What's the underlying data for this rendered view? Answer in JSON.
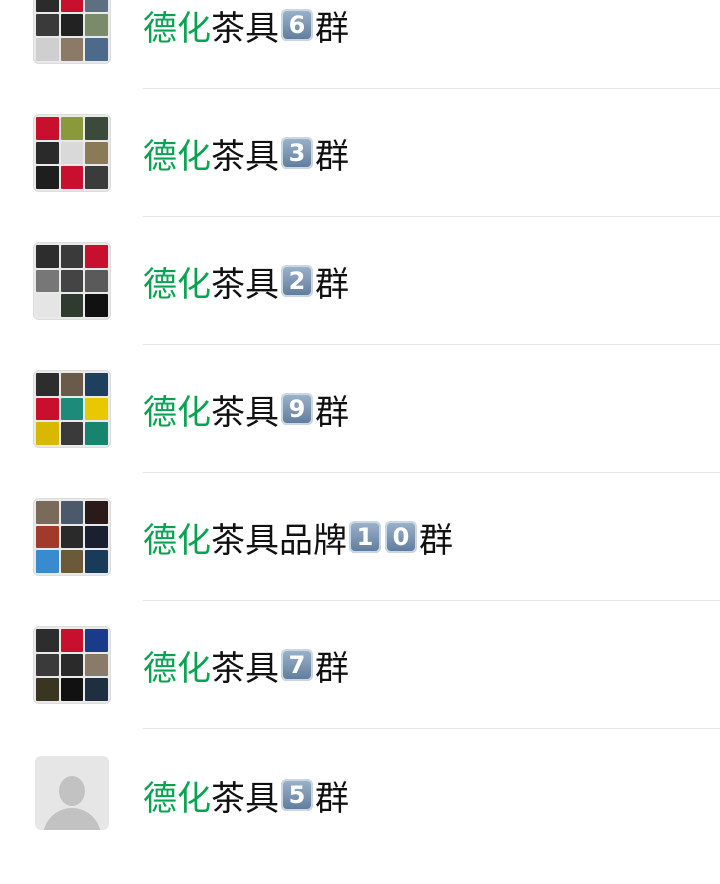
{
  "chats": [
    {
      "highlight": "德化",
      "name": "茶具",
      "badges": [
        "6"
      ],
      "suffix": "群",
      "avatar_colors": [
        "#2b2b2b",
        "#c8102e",
        "#5d6f80",
        "#3a3a3a",
        "#222222",
        "#7a8b6a",
        "#cfcfcf",
        "#8a7a66",
        "#4e6a8a"
      ]
    },
    {
      "highlight": "德化",
      "name": "茶具",
      "badges": [
        "3"
      ],
      "suffix": "群",
      "avatar_colors": [
        "#c8102e",
        "#8a9a3a",
        "#3b4a3a",
        "#2a2a2a",
        "#d9d9d9",
        "#8a7a55",
        "#1e1e1e",
        "#c8102e",
        "#3b3b3b"
      ]
    },
    {
      "highlight": "德化",
      "name": "茶具",
      "badges": [
        "2"
      ],
      "suffix": "群",
      "avatar_colors": [
        "#2d2d2d",
        "#3a3a3a",
        "#c8102e",
        "#777777",
        "#444444",
        "#5a5a5a",
        "#e5e5e5",
        "#2f3b2f",
        "#111111"
      ]
    },
    {
      "highlight": "德化",
      "name": "茶具",
      "badges": [
        "9"
      ],
      "suffix": "群",
      "avatar_colors": [
        "#2d2d2d",
        "#6a5a4a",
        "#1f3f5f",
        "#c8102e",
        "#1e8a7a",
        "#e8c800",
        "#d8b800",
        "#3a3a3a",
        "#16846f"
      ]
    },
    {
      "highlight": "德化",
      "name": "茶具品牌",
      "badges": [
        "1",
        "0"
      ],
      "suffix": "群",
      "avatar_colors": [
        "#7a6a5a",
        "#4a5a6a",
        "#2a1a1a",
        "#a03a2a",
        "#2a2a2a",
        "#1a2030",
        "#3a8ad0",
        "#6a5a3a",
        "#1a3a5a"
      ]
    },
    {
      "highlight": "德化",
      "name": "茶具",
      "badges": [
        "7"
      ],
      "suffix": "群",
      "avatar_colors": [
        "#2d2d2d",
        "#c8102e",
        "#1a3a8a",
        "#3a3a3a",
        "#2a2a2a",
        "#8a7a6a",
        "#3a3520",
        "#111111",
        "#1f2f3f"
      ]
    },
    {
      "highlight": "德化",
      "name": "茶具",
      "badges": [
        "5"
      ],
      "suffix": "群",
      "avatar_colors": []
    }
  ],
  "colors": {
    "highlight": "#07a350",
    "text": "#111111",
    "divider": "#e5e5e5"
  }
}
